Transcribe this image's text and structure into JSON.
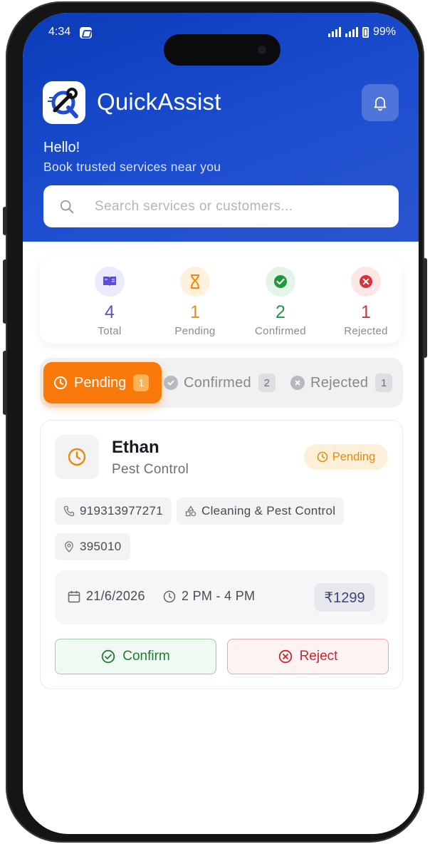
{
  "status_bar": {
    "time": "4:34",
    "battery": "99%"
  },
  "header": {
    "app_name": "QuickAssist",
    "greeting": "Hello!",
    "subtitle": "Book trusted services near you",
    "search_placeholder": "Search services or customers..."
  },
  "stats": [
    {
      "value": "4",
      "label": "Total",
      "color": "#5b4fd8",
      "bg": "#eceaff",
      "icon": "book-icon"
    },
    {
      "value": "1",
      "label": "Pending",
      "color": "#f08a12",
      "bg": "#fff1dc",
      "icon": "hourglass-icon"
    },
    {
      "value": "2",
      "label": "Confirmed",
      "color": "#1e9a3d",
      "bg": "#e4f5e8",
      "icon": "check-circle-icon"
    },
    {
      "value": "1",
      "label": "Rejected",
      "color": "#d8313a",
      "bg": "#fde6e6",
      "icon": "x-circle-icon"
    }
  ],
  "tabs": [
    {
      "label": "Pending",
      "count": "1",
      "active": true,
      "icon": "clock-icon"
    },
    {
      "label": "Confirmed",
      "count": "2",
      "active": false,
      "icon": "check-circle-icon"
    },
    {
      "label": "Rejected",
      "count": "1",
      "active": false,
      "icon": "x-circle-icon"
    }
  ],
  "booking": {
    "customer_name": "Ethan",
    "service": "Pest Control",
    "status": "Pending",
    "phone": "919313977271",
    "category": "Cleaning & Pest Control",
    "pincode": "395010",
    "date": "21/6/2026",
    "time_slot": "2 PM - 4 PM",
    "price": "₹1299",
    "confirm_label": "Confirm",
    "reject_label": "Reject"
  },
  "colors": {
    "header": "#1d4ed0",
    "accent": "#f97a0b"
  }
}
